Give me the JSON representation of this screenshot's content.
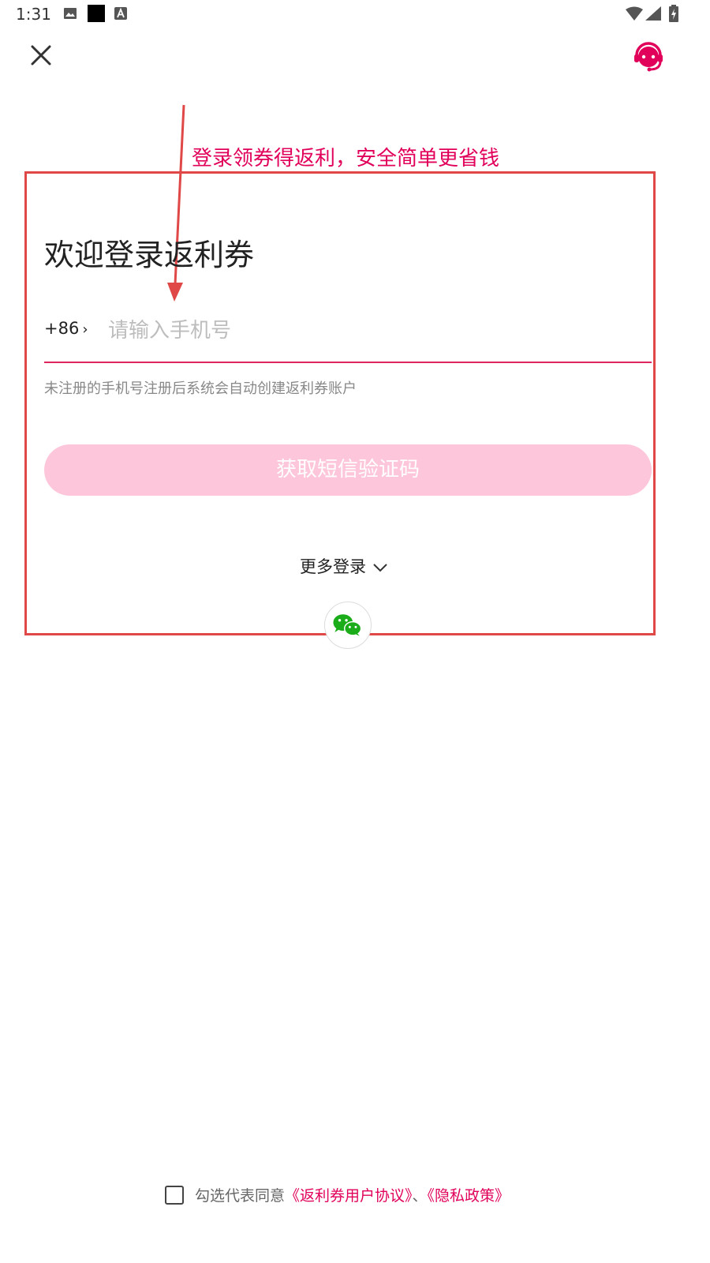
{
  "status_bar": {
    "time": "1:31"
  },
  "annotation": {
    "caption": "登录领券得返利，安全简单更省钱"
  },
  "login": {
    "title": "欢迎登录返利券",
    "country_code": "+86",
    "phone_placeholder": "请输入手机号",
    "phone_value": "",
    "hint": "未注册的手机号注册后系统会自动创建返利券账户",
    "sms_button": "获取短信验证码",
    "more_login": "更多登录"
  },
  "agreement": {
    "prefix": "勾选代表同意",
    "user_agreement": "《返利券用户协议》",
    "separator": "、",
    "privacy_policy": "《隐私政策》",
    "checked": false
  },
  "colors": {
    "accent": "#e1005a",
    "button_disabled": "#fec6da",
    "annotation_red": "#e04848",
    "wechat_green": "#1aad19"
  },
  "icons": [
    "close-icon",
    "customer-service-icon",
    "chevron-right-icon",
    "chevron-down-icon",
    "wechat-icon",
    "image-icon",
    "app-icon",
    "keyboard-icon",
    "wifi-icon",
    "signal-icon",
    "battery-icon"
  ]
}
